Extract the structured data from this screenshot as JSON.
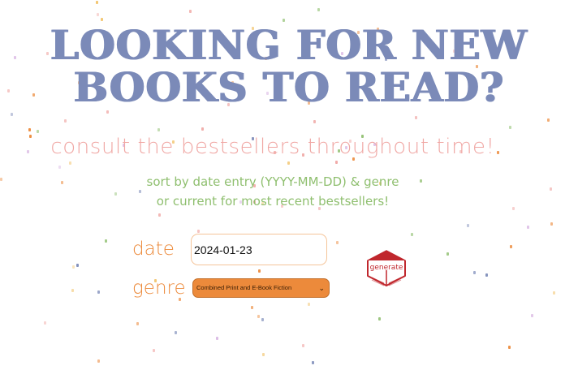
{
  "page": {
    "title_line1": "LOOKING FOR NEW",
    "title_line2": "BOOKS TO READ?",
    "subtitle": "consult the bestsellers throughout time!",
    "hint_line1": "sort by date entry (YYYY-MM-DD) & genre",
    "hint_line2": "or current for most recent bestsellers!"
  },
  "form": {
    "date_label": "date",
    "date_value": "2024-01-23",
    "genre_label": "genre",
    "genre_selected": "Combined Print and E-Book Fiction",
    "generate_label": "generate"
  },
  "colors": {
    "title": "#7b8ab8",
    "subtitle": "#f0a7a4",
    "hint": "#8fbf6f",
    "labels": "#ec8a3b",
    "select_bg": "#ec8a3b",
    "generate_button": "#c0272d"
  },
  "icons": [
    "chevron-down-icon",
    "generate-box-icon"
  ]
}
